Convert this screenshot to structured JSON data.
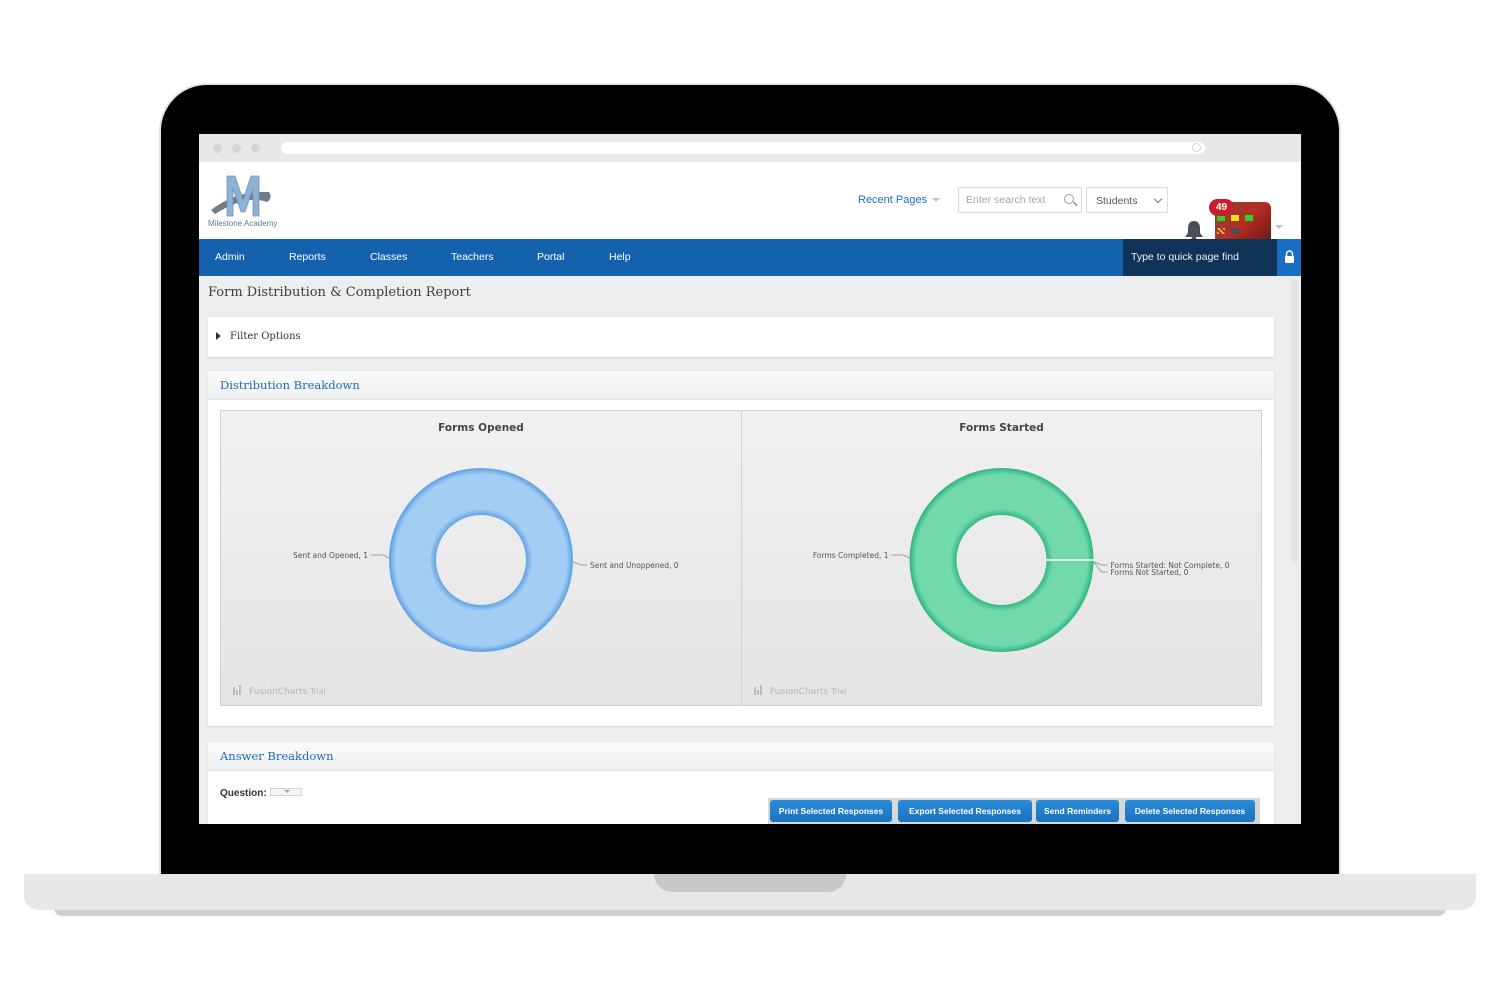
{
  "app": {
    "logo_text": "Milestone Academy",
    "logo_letter": "M"
  },
  "header": {
    "recent_pages": "Recent Pages",
    "search_placeholder": "Enter search text",
    "search_scope": "Students",
    "notification_count": "49"
  },
  "nav": {
    "items": [
      {
        "label": "Admin"
      },
      {
        "label": "Reports"
      },
      {
        "label": "Classes"
      },
      {
        "label": "Teachers"
      },
      {
        "label": "Portal"
      },
      {
        "label": "Help"
      }
    ],
    "quickfind_placeholder": "Type to quick page find"
  },
  "page": {
    "title": "Form Distribution & Completion Report",
    "filter_label": "Filter Options"
  },
  "distribution": {
    "title": "Distribution Breakdown",
    "watermark": "FusionCharts",
    "watermark_suffix": "Trial"
  },
  "chart_data": [
    {
      "type": "pie",
      "variant": "doughnut",
      "title": "Forms Opened",
      "categories": [
        "Sent and Opened",
        "Sent and Unoppened"
      ],
      "values": [
        1,
        0
      ],
      "labels": [
        "Sent and Opened, 1",
        "Sent and Unoppened, 0"
      ],
      "colors": [
        "#a4cdf4",
        "#5a9ee3"
      ]
    },
    {
      "type": "pie",
      "variant": "doughnut",
      "title": "Forms Started",
      "categories": [
        "Forms Completed",
        "Forms Started: Not Complete",
        "Forms Not Started"
      ],
      "values": [
        1,
        0,
        0
      ],
      "labels": [
        "Forms Completed, 1",
        "Forms Started: Not Complete, 0",
        "Forms Not Started, 0"
      ],
      "colors": [
        "#72d8ad",
        "#2bb57a"
      ]
    }
  ],
  "answers": {
    "title": "Answer Breakdown",
    "question_label": "Question:",
    "buttons": [
      {
        "label": "Print Selected Responses"
      },
      {
        "label": "Export Selected Responses"
      },
      {
        "label": "Send Reminders"
      },
      {
        "label": "Delete Selected Responses"
      }
    ]
  }
}
